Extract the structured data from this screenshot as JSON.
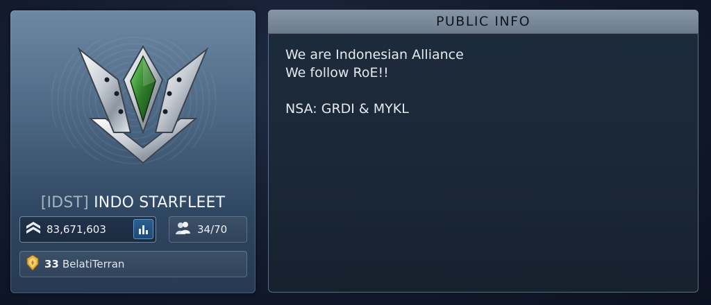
{
  "alliance": {
    "tag": "[IDST]",
    "name": "INDO STARFLEET",
    "emblem_icon": "alliance-emblem-icon",
    "power": "83,671,603",
    "members": "34/70",
    "leader": {
      "level": "33",
      "name": "BelatiTerran"
    }
  },
  "public_info": {
    "header": "PUBLIC INFO",
    "lines": [
      "We are Indonesian Alliance",
      "We follow RoE!!",
      "",
      "NSA: GRDI & MYKL"
    ]
  },
  "colors": {
    "card_top": "#6d88a3",
    "card_bottom": "#263a52",
    "panel_bg": "#1a2736",
    "header_bg": "#7b8a9a",
    "accent_blue": "#2b5e8f",
    "emblem_green": "#3f9b3a",
    "leader_gold": "#e3b23c"
  }
}
